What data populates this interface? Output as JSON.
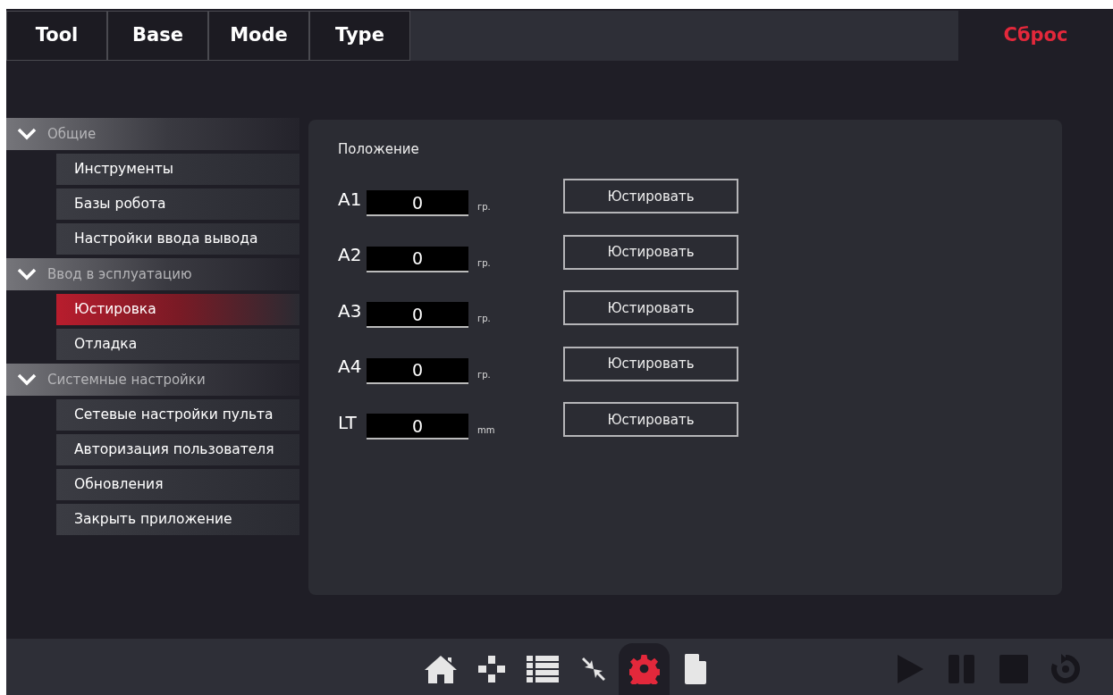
{
  "top_tabs": [
    {
      "label": "Tool"
    },
    {
      "label": "Base"
    },
    {
      "label": "Mode"
    },
    {
      "label": "Type"
    }
  ],
  "reset_button": "Сброс",
  "sidebar": {
    "groups": [
      {
        "label": "Общие",
        "expanded": true,
        "items": [
          {
            "label": "Инструменты",
            "selected": false
          },
          {
            "label": "Базы робота",
            "selected": false
          },
          {
            "label": "Настройки ввода вывода",
            "selected": false
          }
        ]
      },
      {
        "label": "Ввод в эсплуатацию",
        "expanded": true,
        "items": [
          {
            "label": "Юстировка",
            "selected": true
          },
          {
            "label": "Отладка",
            "selected": false
          }
        ]
      },
      {
        "label": "Системные настройки",
        "expanded": true,
        "items": [
          {
            "label": "Сетевые настройки пульта",
            "selected": false
          },
          {
            "label": "Авторизация пользователя",
            "selected": false
          },
          {
            "label": "Обновления",
            "selected": false
          },
          {
            "label": "Закрыть приложение",
            "selected": false
          }
        ]
      }
    ]
  },
  "panel": {
    "title": "Положение",
    "axes": [
      {
        "label": "A1",
        "value": "0",
        "unit": "гр.",
        "button": "Юстировать"
      },
      {
        "label": "A2",
        "value": "0",
        "unit": "гр.",
        "button": "Юстировать"
      },
      {
        "label": "A3",
        "value": "0",
        "unit": "гр.",
        "button": "Юстировать"
      },
      {
        "label": "A4",
        "value": "0",
        "unit": "гр.",
        "button": "Юстировать"
      },
      {
        "label": "LT",
        "value": "0",
        "unit": "mm",
        "button": "Юстировать"
      }
    ]
  },
  "toolbar": {
    "nav": [
      {
        "kind": "home",
        "selected": false
      },
      {
        "kind": "jog",
        "selected": false
      },
      {
        "kind": "list",
        "selected": false
      },
      {
        "kind": "collapse",
        "selected": false
      },
      {
        "kind": "settings",
        "selected": true
      },
      {
        "kind": "file",
        "selected": false
      }
    ],
    "controls": [
      {
        "kind": "play",
        "disabled": true
      },
      {
        "kind": "pause",
        "disabled": true
      },
      {
        "kind": "stop",
        "disabled": true
      },
      {
        "kind": "reset",
        "disabled": true
      }
    ]
  }
}
